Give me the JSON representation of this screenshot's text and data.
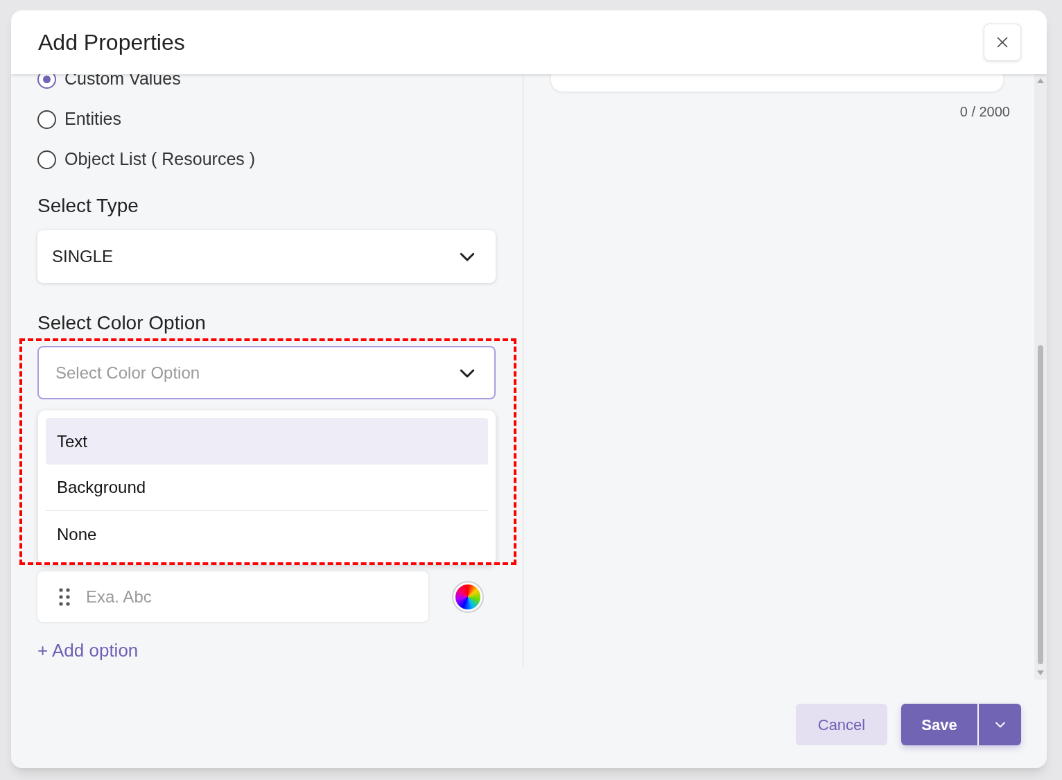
{
  "dialog": {
    "title": "Add Properties"
  },
  "value_source": [
    {
      "label": "Custom Values",
      "selected": true
    },
    {
      "label": "Entities",
      "selected": false
    },
    {
      "label": "Object List ( Resources )",
      "selected": false
    }
  ],
  "select_type": {
    "label": "Select Type",
    "value": "SINGLE"
  },
  "color_option": {
    "label": "Select Color Option",
    "placeholder": "Select Color Option",
    "expanded": true,
    "options": [
      {
        "label": "Text",
        "selected": true
      },
      {
        "label": "Background",
        "selected": false
      },
      {
        "label": "None",
        "selected": false
      }
    ]
  },
  "option_input": {
    "placeholder": "Exa. Abc"
  },
  "add_option": "+ Add option",
  "description": {
    "count": "0 / 2000"
  },
  "buttons": {
    "cancel": "Cancel",
    "save": "Save"
  }
}
